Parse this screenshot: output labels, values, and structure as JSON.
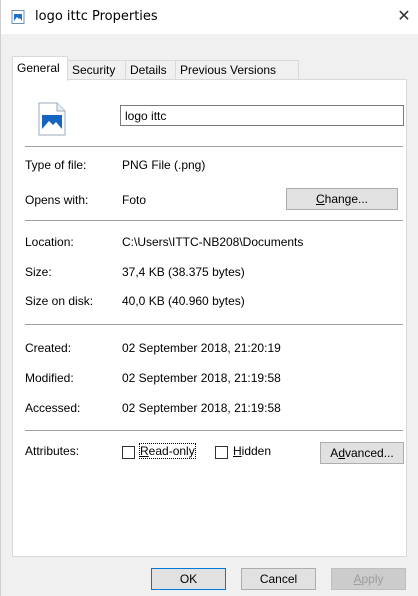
{
  "window": {
    "title": "logo ittc Properties",
    "close_glyph": "✕"
  },
  "tabs": [
    {
      "label": "General",
      "active": true
    },
    {
      "label": "Security",
      "active": false
    },
    {
      "label": "Details",
      "active": false
    },
    {
      "label": "Previous Versions",
      "active": false
    }
  ],
  "general": {
    "file_icon": "image-file-icon",
    "name_value": "logo ittc",
    "type_label": "Type of file:",
    "type_value": "PNG File (.png)",
    "opens_label": "Opens with:",
    "opens_value": "Foto",
    "change_button": {
      "label": "Change...",
      "mnemonic": "C",
      "rest": "hange..."
    },
    "location_label": "Location:",
    "location_value": "C:\\Users\\ITTC-NB208\\Documents",
    "size_label": "Size:",
    "size_value": "37,4 KB (38.375 bytes)",
    "size_disk_label": "Size on disk:",
    "size_disk_value": "40,0 KB (40.960 bytes)",
    "created_label": "Created:",
    "created_value": "02 September 2018, 21:20:19",
    "modified_label": "Modified:",
    "modified_value": "02 September 2018, 21:19:58",
    "accessed_label": "Accessed:",
    "accessed_value": "02 September 2018, 21:19:58",
    "attributes_label": "Attributes:",
    "readonly": {
      "label": "Read-only",
      "mnemonic": "R",
      "rest": "ead-only",
      "checked": false
    },
    "hidden": {
      "label": "Hidden",
      "mnemonic": "H",
      "rest": "idden",
      "checked": false
    },
    "advanced_button": {
      "label": "Advanced...",
      "pre": "A",
      "mnemonic": "d",
      "rest": "vanced..."
    }
  },
  "footer": {
    "ok": "OK",
    "cancel": "Cancel",
    "apply": {
      "label": "Apply",
      "mnemonic": "A",
      "rest": "pply",
      "disabled": true
    }
  },
  "colors": {
    "accent": "#0078d7",
    "window_bg": "#f0f0f0",
    "panel_bg": "#ffffff"
  }
}
